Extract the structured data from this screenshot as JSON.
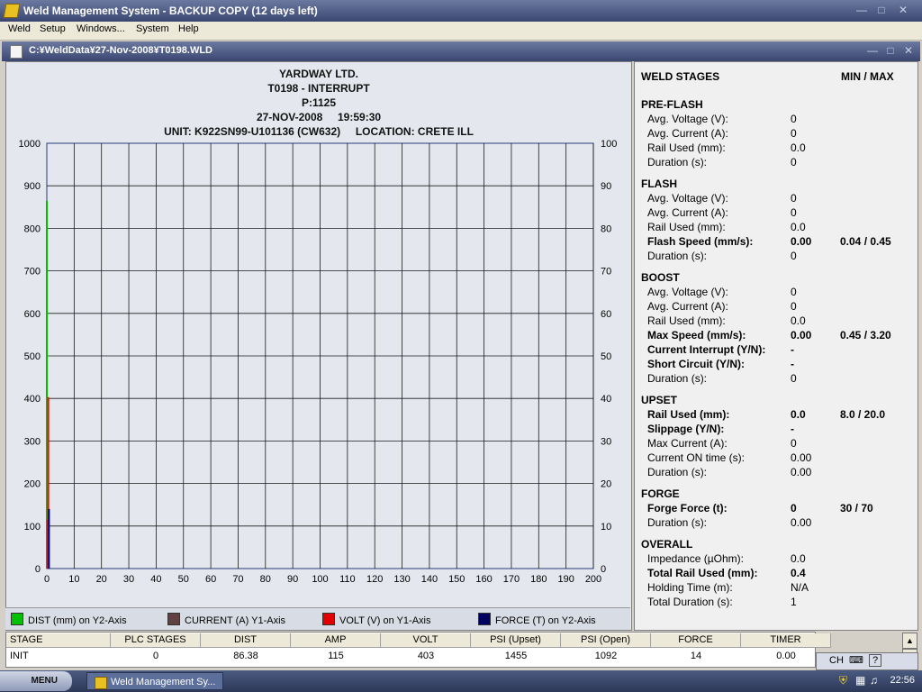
{
  "window": {
    "title": "Weld Management System  - BACKUP COPY (12 days left)",
    "doc_title": "C:¥WeldData¥27-Nov-2008¥T0198.WLD"
  },
  "menu": [
    "Weld",
    "Setup",
    "Windows...",
    "System",
    "Help"
  ],
  "chart_header": {
    "company": "YARDWAY LTD.",
    "weld_id": "T0198 - INTERRUPT",
    "p": "P:1125",
    "datetime": "27-NOV-2008     19:59:30",
    "unit_location": "UNIT: K922SN99-U101136 (CW632)     LOCATION: CRETE ILL"
  },
  "chart_data": {
    "type": "line",
    "x_ticks": [
      0,
      10,
      20,
      30,
      40,
      50,
      60,
      70,
      80,
      90,
      100,
      110,
      120,
      130,
      140,
      150,
      160,
      170,
      180,
      190,
      200
    ],
    "xlim": [
      0,
      200
    ],
    "y1_ticks": [
      0,
      100,
      200,
      300,
      400,
      500,
      600,
      700,
      800,
      900,
      1000
    ],
    "y1lim": [
      0,
      1000
    ],
    "y2_ticks": [
      0,
      10,
      20,
      30,
      40,
      50,
      60,
      70,
      80,
      90,
      100
    ],
    "y2lim": [
      0,
      100
    ],
    "grid": true,
    "series": [
      {
        "name": "DIST (mm) on Y2-Axis",
        "axis": "y2",
        "color": "#00c000",
        "points": [
          [
            0,
            0
          ],
          [
            0,
            86.5
          ]
        ]
      },
      {
        "name": "CURRENT (A) Y1-Axis",
        "axis": "y1",
        "color": "#604040",
        "points": [
          [
            0,
            0
          ],
          [
            0,
            115
          ]
        ]
      },
      {
        "name": "VOLT (V) on Y1-Axis",
        "axis": "y1",
        "color": "#ff0000",
        "points": [
          [
            0,
            0
          ],
          [
            0,
            403
          ]
        ]
      },
      {
        "name": "FORCE (T) on Y2-Axis",
        "axis": "y2",
        "color": "#000080",
        "points": [
          [
            0,
            0
          ],
          [
            0,
            14
          ]
        ]
      }
    ]
  },
  "legend": [
    {
      "label": "DIST (mm) on Y2-Axis",
      "color": "#00c000"
    },
    {
      "label": "CURRENT (A) Y1-Axis",
      "color": "#604040"
    },
    {
      "label": "VOLT (V) on Y1-Axis",
      "color": "#e00000"
    },
    {
      "label": "FORCE (T) on Y2-Axis",
      "color": "#000060"
    }
  ],
  "stages": {
    "header": "WELD STAGES",
    "minmax_header": "MIN / MAX",
    "groups": [
      {
        "title": "PRE-FLASH",
        "rows": [
          {
            "label": "Avg. Voltage (V):",
            "value": "0",
            "minmax": "",
            "bold": false
          },
          {
            "label": "Avg. Current (A):",
            "value": "0",
            "minmax": "",
            "bold": false
          },
          {
            "label": "Rail Used (mm):",
            "value": "0.0",
            "minmax": "",
            "bold": false
          },
          {
            "label": "Duration (s):",
            "value": "0",
            "minmax": "",
            "bold": false
          }
        ]
      },
      {
        "title": "FLASH",
        "rows": [
          {
            "label": "Avg. Voltage (V):",
            "value": "0",
            "minmax": "",
            "bold": false
          },
          {
            "label": "Avg. Current (A):",
            "value": "0",
            "minmax": "",
            "bold": false
          },
          {
            "label": "Rail Used (mm):",
            "value": "0.0",
            "minmax": "",
            "bold": false
          },
          {
            "label": "Flash Speed (mm/s):",
            "value": "0.00",
            "minmax": "0.04 / 0.45",
            "bold": true
          },
          {
            "label": "Duration (s):",
            "value": "0",
            "minmax": "",
            "bold": false
          }
        ]
      },
      {
        "title": "BOOST",
        "rows": [
          {
            "label": "Avg. Voltage (V):",
            "value": "0",
            "minmax": "",
            "bold": false
          },
          {
            "label": "Avg. Current (A):",
            "value": "0",
            "minmax": "",
            "bold": false
          },
          {
            "label": "Rail Used (mm):",
            "value": "0.0",
            "minmax": "",
            "bold": false
          },
          {
            "label": "Max Speed (mm/s):",
            "value": "0.00",
            "minmax": "0.45 / 3.20",
            "bold": true
          },
          {
            "label": "Current Interrupt (Y/N):",
            "value": "-",
            "minmax": "",
            "bold": true
          },
          {
            "label": "Short Circuit (Y/N):",
            "value": "-",
            "minmax": "",
            "bold": true
          },
          {
            "label": "Duration (s):",
            "value": "0",
            "minmax": "",
            "bold": false
          }
        ]
      },
      {
        "title": "UPSET",
        "rows": [
          {
            "label": "Rail Used (mm):",
            "value": "0.0",
            "minmax": "8.0 / 20.0",
            "bold": true
          },
          {
            "label": "Slippage (Y/N):",
            "value": "-",
            "minmax": "",
            "bold": true
          },
          {
            "label": "Max Current (A):",
            "value": "0",
            "minmax": "",
            "bold": false
          },
          {
            "label": "Current ON time (s):",
            "value": "0.00",
            "minmax": "",
            "bold": false
          },
          {
            "label": "Duration (s):",
            "value": "0.00",
            "minmax": "",
            "bold": false
          }
        ]
      },
      {
        "title": "FORGE",
        "rows": [
          {
            "label": "Forge Force (t):",
            "value": "0",
            "minmax": "30 / 70",
            "bold": true
          },
          {
            "label": "Duration (s):",
            "value": "0.00",
            "minmax": "",
            "bold": false
          }
        ]
      },
      {
        "title": "OVERALL",
        "rows": [
          {
            "label": "Impedance (µOhm):",
            "value": "0.0",
            "minmax": "",
            "bold": false
          },
          {
            "label": "Total Rail Used (mm):",
            "value": "0.4",
            "minmax": "",
            "bold": true
          },
          {
            "label": "Holding Time (m):",
            "value": "N/A",
            "minmax": "",
            "bold": false
          },
          {
            "label": "Total Duration (s):",
            "value": "1",
            "minmax": "",
            "bold": false
          }
        ]
      }
    ]
  },
  "table": {
    "headers": [
      "STAGE",
      "PLC STAGES",
      "DIST",
      "AMP",
      "VOLT",
      "PSI (Upset)",
      "PSI (Open)",
      "FORCE",
      "TIMER"
    ],
    "row": [
      "INIT",
      "0",
      "86.38",
      "115",
      "403",
      "1455",
      "1092",
      "14",
      "0.00"
    ]
  },
  "taskbar": {
    "start_label": "MENU",
    "task_label": "Weld Management Sy...",
    "tray_lang": "CH",
    "clock": "22:56"
  }
}
